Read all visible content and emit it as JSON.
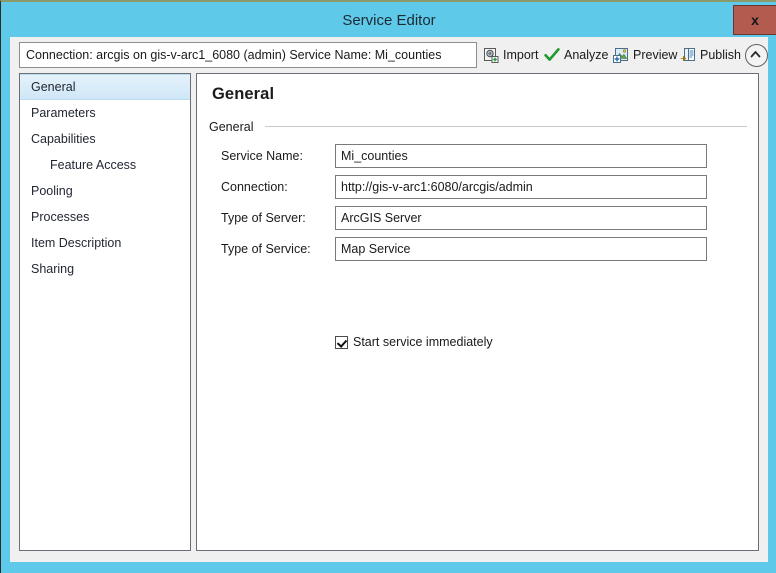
{
  "window": {
    "title": "Service Editor",
    "close_label": "x",
    "frame_color": "#5fc9ea",
    "close_color": "#b45b50"
  },
  "toolbar": {
    "connection_summary": "Connection: arcgis on gis-v-arc1_6080 (admin)   Service Name: Mi_counties",
    "buttons": [
      {
        "label": "Import",
        "icon": "import-icon"
      },
      {
        "label": "Analyze",
        "icon": "checkmark-icon"
      },
      {
        "label": "Preview",
        "icon": "preview-icon"
      },
      {
        "label": "Publish",
        "icon": "publish-icon"
      }
    ],
    "collapse_icon": "chevron-up-icon"
  },
  "sidebar": {
    "items": [
      {
        "label": "General",
        "selected": true,
        "indent": false
      },
      {
        "label": "Parameters",
        "selected": false,
        "indent": false
      },
      {
        "label": "Capabilities",
        "selected": false,
        "indent": false
      },
      {
        "label": "Feature Access",
        "selected": false,
        "indent": true
      },
      {
        "label": "Pooling",
        "selected": false,
        "indent": false
      },
      {
        "label": "Processes",
        "selected": false,
        "indent": false
      },
      {
        "label": "Item Description",
        "selected": false,
        "indent": false
      },
      {
        "label": "Sharing",
        "selected": false,
        "indent": false
      }
    ]
  },
  "main": {
    "page_title": "General",
    "group_label": "General",
    "fields": [
      {
        "label": "Service Name:",
        "value": "Mi_counties"
      },
      {
        "label": "Connection:",
        "value": "http://gis-v-arc1:6080/arcgis/admin"
      },
      {
        "label": "Type of Server:",
        "value": "ArcGIS Server"
      },
      {
        "label": "Type of Service:",
        "value": "Map Service"
      }
    ],
    "checkbox": {
      "label": "Start service immediately",
      "checked": true
    }
  }
}
